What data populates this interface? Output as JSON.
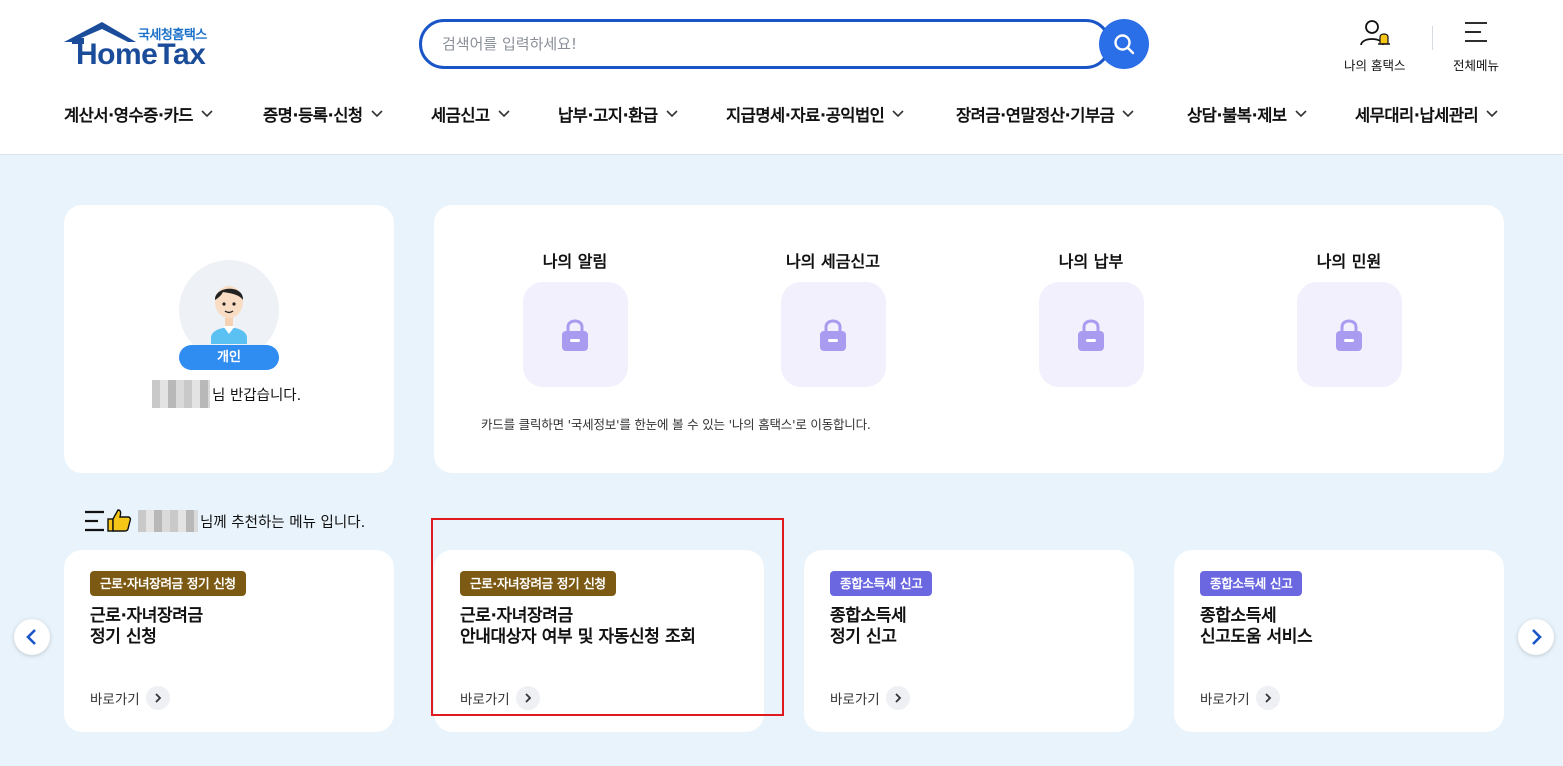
{
  "logo": {
    "tagline": "국세청홈택스",
    "brand": "HomeTax"
  },
  "search": {
    "placeholder": "검색어를 입력하세요!",
    "value": ""
  },
  "util": {
    "my_hometax": "나의 홈택스",
    "all_menu": "전체메뉴"
  },
  "gnb": [
    {
      "label": "계산서·영수증·카드"
    },
    {
      "label": "증명·등록·신청"
    },
    {
      "label": "세금신고"
    },
    {
      "label": "납부·고지·환급"
    },
    {
      "label": "지급명세·자료·공익법인"
    },
    {
      "label": "장려금·연말정산·기부금"
    },
    {
      "label": "상담·불복·제보"
    },
    {
      "label": "세무대리·납세관리"
    }
  ],
  "profile": {
    "badge": "개인",
    "greeting": "님 반갑습니다."
  },
  "mine": {
    "items": [
      {
        "title": "나의 알림"
      },
      {
        "title": "나의 세금신고"
      },
      {
        "title": "나의 납부"
      },
      {
        "title": "나의 민원"
      }
    ],
    "note": "카드를 클릭하면 '국세정보'를 한눈에 볼 수 있는 '나의 홈택스'로 이동합니다."
  },
  "recommend": {
    "header": "님께 추천하는 메뉴 입니다.",
    "goto_label": "바로가기",
    "cards": [
      {
        "tag": "근로·자녀장려금 정기 신청",
        "tag_color": "#7d5a14",
        "title_line1": "근로·자녀장려금",
        "title_line2": "정기 신청"
      },
      {
        "tag": "근로·자녀장려금 정기 신청",
        "tag_color": "#7d5a14",
        "title_line1": "근로·자녀장려금",
        "title_line2": "안내대상자 여부 및 자동신청 조회"
      },
      {
        "tag": "종합소득세 신고",
        "tag_color": "#6a67e0",
        "title_line1": "종합소득세",
        "title_line2": "정기 신고"
      },
      {
        "tag": "종합소득세 신고",
        "tag_color": "#6a67e0",
        "title_line1": "종합소득세",
        "title_line2": "신고도움 서비스"
      }
    ]
  },
  "colors": {
    "accent": "#2a6ee8",
    "highlight": "#e0191e",
    "lock": "#a99bf0"
  }
}
